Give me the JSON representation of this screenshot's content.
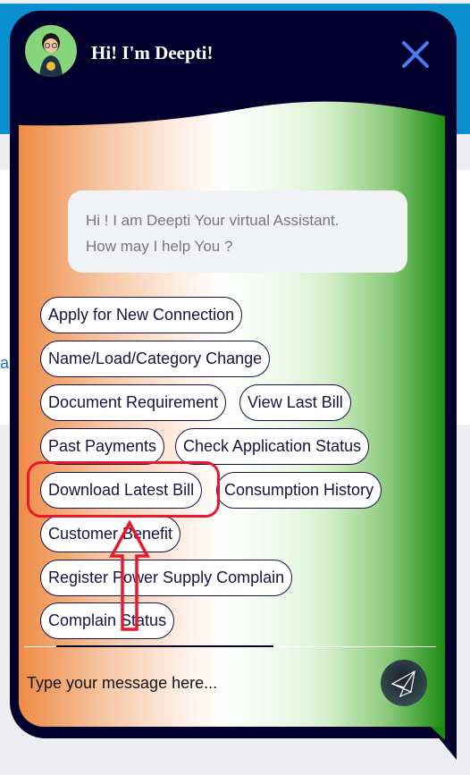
{
  "page": {
    "side_link_text": "a"
  },
  "chat": {
    "title": "Hi! I'm Deepti!",
    "greeting_line1": "Hi ! I am Deepti Your virtual Assistant.",
    "greeting_line2": "How may I help You ?",
    "options": [
      "Apply for New Connection",
      "Name/Load/Category Change",
      "Document Requirement",
      "View Last Bill",
      "Past Payments",
      "Check Application Status",
      "Download Latest Bill",
      "Consumption History",
      "Customer Benefit",
      "Register Power Supply Complain",
      "Complain Status"
    ],
    "input_placeholder": "Type your message here..."
  },
  "colors": {
    "header": "#03002e",
    "close": "#4a7cf0",
    "annotation": "#e8192c",
    "saffron": "#ef8a45",
    "green": "#1b8c12"
  },
  "icons": {
    "close": "close-icon",
    "send": "send-paper-plane-icon",
    "avatar": "deepti-avatar"
  }
}
